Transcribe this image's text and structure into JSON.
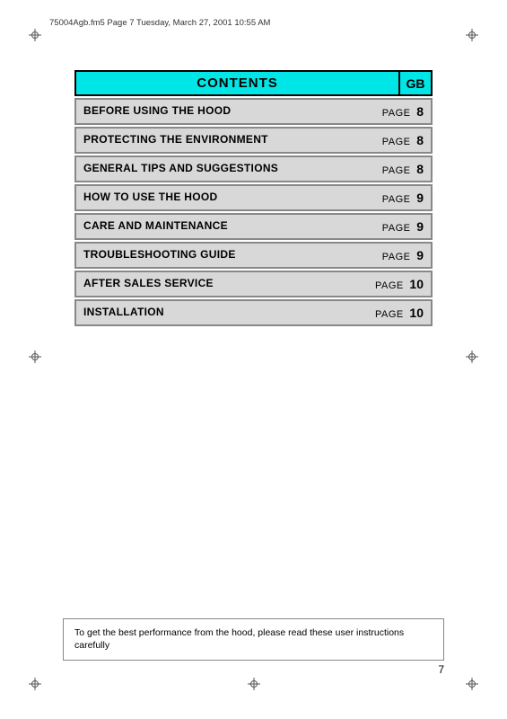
{
  "fileInfo": "75004Agb.fm5  Page 7  Tuesday, March 27, 2001  10:55 AM",
  "header": {
    "contentsLabel": "CONTENTS",
    "gbLabel": "GB"
  },
  "tocRows": [
    {
      "label": "BEFORE USING THE HOOD",
      "pageWord": "PAGE",
      "pageNum": "8"
    },
    {
      "label": "PROTECTING THE ENVIRONMENT",
      "pageWord": "PAGE",
      "pageNum": "8"
    },
    {
      "label": "GENERAL TIPS AND SUGGESTIONS",
      "pageWord": "PAGE",
      "pageNum": "8"
    },
    {
      "label": "HOW TO USE THE HOOD",
      "pageWord": "PAGE",
      "pageNum": "9"
    },
    {
      "label": "CARE AND MAINTENANCE",
      "pageWord": "PAGE",
      "pageNum": "9"
    },
    {
      "label": "TROUBLESHOOTING GUIDE",
      "pageWord": "PAGE",
      "pageNum": "9"
    },
    {
      "label": "AFTER SALES SERVICE",
      "pageWord": "PAGE",
      "pageNum": "10"
    },
    {
      "label": "INSTALLATION",
      "pageWord": "PAGE",
      "pageNum": "10"
    }
  ],
  "bottomNote": "To get the best performance from the hood, please read these user instructions carefully",
  "pageNumber": "7"
}
